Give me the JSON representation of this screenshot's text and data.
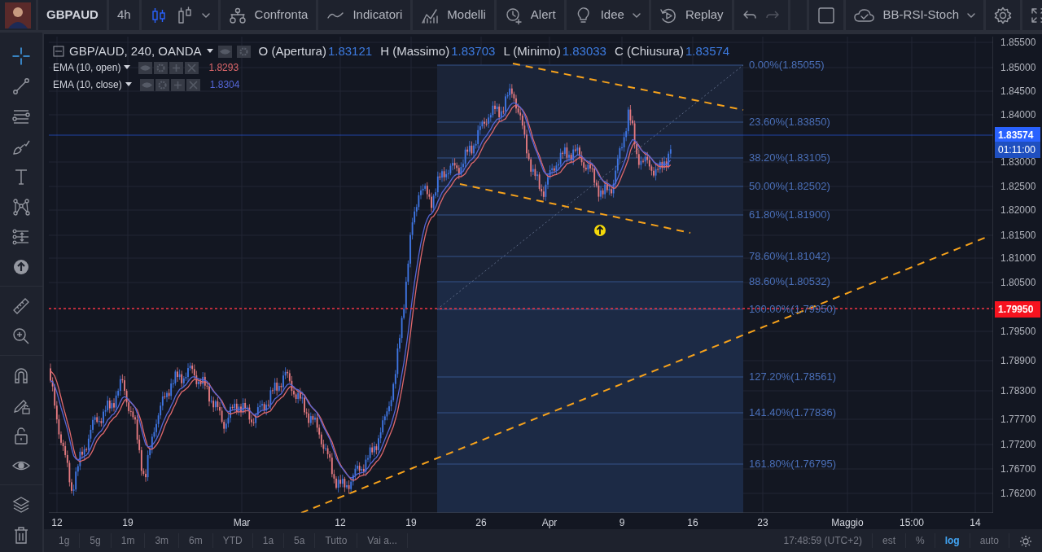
{
  "header": {
    "symbol": "GBPAUD",
    "interval": "4h",
    "buttons": [
      {
        "label": "Confronta",
        "dropdown": false
      },
      {
        "label": "Indicatori",
        "dropdown": false
      },
      {
        "label": "Modelli",
        "dropdown": false
      },
      {
        "label": "Alert",
        "dropdown": false
      },
      {
        "label": "Idee",
        "dropdown": true
      },
      {
        "label": "Replay",
        "dropdown": false
      }
    ],
    "layout_name": "BB-RSI-Stoch"
  },
  "tools": [
    {
      "selected": true
    },
    {
      "selected": false
    },
    {
      "selected": false
    },
    {
      "selected": false
    },
    {
      "selected": false
    },
    {
      "selected": false
    },
    {
      "selected": false
    },
    {
      "selected": false
    },
    {
      "selected": false
    },
    {
      "selected": false
    },
    {
      "selected": false
    },
    {
      "selected": false
    },
    {
      "selected": false
    },
    {
      "selected": false
    },
    {
      "selected": false
    },
    {
      "selected": false
    }
  ],
  "legend": {
    "title": "GBP/AUD, 240, OANDA",
    "ohlc": [
      {
        "label": "O (Apertura)",
        "value": "1.83121"
      },
      {
        "label": "H (Massimo)",
        "value": "1.83703"
      },
      {
        "label": "L (Minimo)",
        "value": "1.83033"
      },
      {
        "label": "C (Chiusura)",
        "value": "1.83574"
      }
    ],
    "indicators": [
      {
        "name": "EMA (10, open)",
        "value": "1.8293",
        "color": "#e0686c"
      },
      {
        "name": "EMA (10, close)",
        "value": "1.8304",
        "color": "#5466d6"
      }
    ]
  },
  "fib_levels": [
    {
      "label": "0.00%(1.85055)"
    },
    {
      "label": "23.60%(1.83850)"
    },
    {
      "label": "38.20%(1.83105)"
    },
    {
      "label": "50.00%(1.82502)"
    },
    {
      "label": "61.80%(1.81900)"
    },
    {
      "label": "78.60%(1.81042)"
    },
    {
      "label": "88.60%(1.80532)"
    },
    {
      "label": "100.00%(1.79950)"
    },
    {
      "label": "127.20%(1.78561)"
    },
    {
      "label": "141.40%(1.77836)"
    },
    {
      "label": "161.80%(1.76795)"
    }
  ],
  "price_axis": {
    "ticks": [
      "1.85500",
      "1.85000",
      "1.84500",
      "1.84000",
      "1.83000",
      "1.82500",
      "1.82000",
      "1.81500",
      "1.81000",
      "1.80500",
      "1.79500",
      "1.78900",
      "1.78300",
      "1.77700",
      "1.77200",
      "1.76700",
      "1.76200"
    ],
    "last_price": "1.83574",
    "countdown": "01:11:00",
    "line_price": "1.79950"
  },
  "time_axis": [
    "12",
    "19",
    "Mar",
    "12",
    "19",
    "26",
    "Apr",
    "9",
    "16",
    "23",
    "Maggio",
    "15:00",
    "14"
  ],
  "bottom_bar": {
    "ranges": [
      "1g",
      "5g",
      "1m",
      "3m",
      "6m",
      "YTD",
      "1a",
      "5a",
      "Tutto",
      "Vai a..."
    ],
    "clock": "17:48:59 (UTC+2)",
    "scale_options": [
      {
        "label": "est",
        "selected": false
      },
      {
        "label": "%",
        "selected": false
      },
      {
        "label": "log",
        "selected": true
      },
      {
        "label": "auto",
        "selected": false
      }
    ]
  }
}
